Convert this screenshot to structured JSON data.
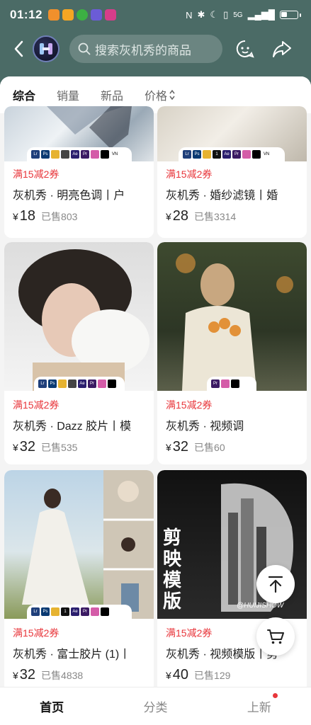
{
  "status_bar": {
    "time": "01:12",
    "network_label": "5G",
    "notification_icons": [
      "sale-app-icon",
      "shield-app-icon",
      "wechat-icon",
      "music-app-icon",
      "shopping-app-icon"
    ]
  },
  "top_bar": {
    "search_placeholder": "搜索灰机秀的商品",
    "icons": [
      "back-icon",
      "shop-logo",
      "search-icon",
      "customer-service-icon",
      "share-icon"
    ]
  },
  "sort_tabs": [
    {
      "label": "综合",
      "active": true
    },
    {
      "label": "销量",
      "active": false
    },
    {
      "label": "新品",
      "active": false
    },
    {
      "label": "价格",
      "active": false
    }
  ],
  "products": [
    {
      "promo": "满15减2券",
      "title": "灰机秀 · 明亮色调丨户",
      "yen": "¥",
      "price": "18",
      "sold": "已售803",
      "apps": [
        "Lr",
        "Ps",
        "",
        "",
        "Ae",
        "Pr",
        "",
        "",
        "VN"
      ]
    },
    {
      "promo": "满15减2券",
      "title": "灰机秀 · 婚纱滤镜丨婚",
      "yen": "¥",
      "price": "28",
      "sold": "已售3314",
      "apps": [
        "Lr",
        "Ps",
        "",
        "1",
        "Ae",
        "Pr",
        "",
        "",
        "VN"
      ]
    },
    {
      "promo": "满15减2券",
      "title": "灰机秀 · Dazz 胶片丨模",
      "yen": "¥",
      "price": "32",
      "sold": "已售535",
      "apps": [
        "Lr",
        "Ps",
        "",
        "",
        "Ae",
        "Pr",
        "",
        ""
      ]
    },
    {
      "promo": "满15减2券",
      "title": "灰机秀 · 视频调",
      "yen": "¥",
      "price": "32",
      "sold": "已售60",
      "apps": [
        "Pr",
        "",
        ""
      ]
    },
    {
      "promo": "满15减2券",
      "title": "灰机秀 · 富士胶片 (1)丨",
      "yen": "¥",
      "price": "32",
      "sold": "已售4838",
      "apps": [
        "Lr",
        "Ps",
        "",
        "1",
        "Ae",
        "Pr",
        "",
        ""
      ]
    },
    {
      "promo": "满15减2券",
      "title": "灰机秀 · 视频模版丨剪",
      "yen": "¥",
      "price": "40",
      "sold": "已售129",
      "overlay_text": "剪映模版",
      "overlay_caption": "@HUIJISHOW",
      "apps": []
    }
  ],
  "bottom_nav": [
    {
      "label": "首页",
      "active": true
    },
    {
      "label": "分类",
      "active": false
    },
    {
      "label": "上新",
      "active": false,
      "badge": true
    }
  ],
  "colors": {
    "header_bg": "#4b6b66",
    "promo_red": "#e8363b"
  }
}
